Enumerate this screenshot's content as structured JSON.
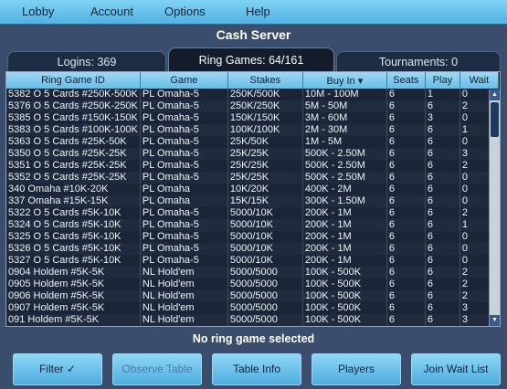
{
  "menu": {
    "items": [
      "Lobby",
      "Account",
      "Options",
      "Help"
    ]
  },
  "header": {
    "title": "Cash Server"
  },
  "tabs": [
    {
      "label": "Logins: 369",
      "active": false
    },
    {
      "label": "Ring Games: 64/161",
      "active": true
    },
    {
      "label": "Tournaments: 0",
      "active": false
    }
  ],
  "table": {
    "columns": [
      "Ring Game ID",
      "Game",
      "Stakes",
      "Buy In ▾",
      "Seats",
      "Play",
      "Wait"
    ],
    "rows": [
      [
        "5382 O 5 Cards #250K-500K",
        "PL Omaha-5",
        "250K/500K",
        "10M - 100M",
        "6",
        "1",
        "0"
      ],
      [
        "5376 O 5 Cards #250K-250K",
        "PL Omaha-5",
        "250K/250K",
        "5M - 50M",
        "6",
        "6",
        "2"
      ],
      [
        "5385 O 5 Cards #150K-150K",
        "PL Omaha-5",
        "150K/150K",
        "3M - 60M",
        "6",
        "3",
        "0"
      ],
      [
        "5383 O 5 Cards #100K-100K",
        "PL Omaha-5",
        "100K/100K",
        "2M - 30M",
        "6",
        "6",
        "1"
      ],
      [
        "5363 O 5 Cards #25K-50K",
        "PL Omaha-5",
        "25K/50K",
        "1M - 5M",
        "6",
        "6",
        "0"
      ],
      [
        "5350 O 5 Cards #25K-25K",
        "PL Omaha-5",
        "25K/25K",
        "500K - 2.50M",
        "6",
        "6",
        "3"
      ],
      [
        "5351 O 5 Cards #25K-25K",
        "PL Omaha-5",
        "25K/25K",
        "500K - 2.50M",
        "6",
        "6",
        "2"
      ],
      [
        "5352 O 5 Cards #25K-25K",
        "PL Omaha-5",
        "25K/25K",
        "500K - 2.50M",
        "6",
        "6",
        "0"
      ],
      [
        "340 Omaha #10K-20K",
        "PL Omaha",
        "10K/20K",
        "400K - 2M",
        "6",
        "6",
        "0"
      ],
      [
        "337 Omaha #15K-15K",
        "PL Omaha",
        "15K/15K",
        "300K - 1.50M",
        "6",
        "6",
        "0"
      ],
      [
        "5322 O 5 Cards #5K-10K",
        "PL Omaha-5",
        "5000/10K",
        "200K - 1M",
        "6",
        "6",
        "2"
      ],
      [
        "5324 O 5 Cards #5K-10K",
        "PL Omaha-5",
        "5000/10K",
        "200K - 1M",
        "6",
        "6",
        "1"
      ],
      [
        "5325 O 5 Cards #5K-10K",
        "PL Omaha-5",
        "5000/10K",
        "200K - 1M",
        "6",
        "6",
        "0"
      ],
      [
        "5326 O 5 Cards #5K-10K",
        "PL Omaha-5",
        "5000/10K",
        "200K - 1M",
        "6",
        "6",
        "0"
      ],
      [
        "5327 O 5 Cards #5K-10K",
        "PL Omaha-5",
        "5000/10K",
        "200K - 1M",
        "6",
        "6",
        "0"
      ],
      [
        "0904 Holdem #5K-5K",
        "NL Hold'em",
        "5000/5000",
        "100K - 500K",
        "6",
        "6",
        "2"
      ],
      [
        "0905 Holdem #5K-5K",
        "NL Hold'em",
        "5000/5000",
        "100K - 500K",
        "6",
        "6",
        "2"
      ],
      [
        "0906 Holdem #5K-5K",
        "NL Hold'em",
        "5000/5000",
        "100K - 500K",
        "6",
        "6",
        "2"
      ],
      [
        "0907 Holdem #5K-5K",
        "NL Hold'em",
        "5000/5000",
        "100K - 500K",
        "6",
        "6",
        "3"
      ],
      [
        "091 Holdem #5K-5K",
        "NL Hold'em",
        "5000/5000",
        "100K - 500K",
        "6",
        "6",
        "3"
      ]
    ]
  },
  "status": {
    "text": "No ring game selected"
  },
  "buttons": [
    {
      "label": "Filter ✓",
      "enabled": true
    },
    {
      "label": "Observe Table",
      "enabled": false
    },
    {
      "label": "Table Info",
      "enabled": true
    },
    {
      "label": "Players",
      "enabled": true
    },
    {
      "label": "Join Wait List",
      "enabled": true
    }
  ],
  "colors": {
    "accent": "#5ab8e6",
    "background": "#3a4d6c",
    "table_bg": "#1a2234"
  }
}
